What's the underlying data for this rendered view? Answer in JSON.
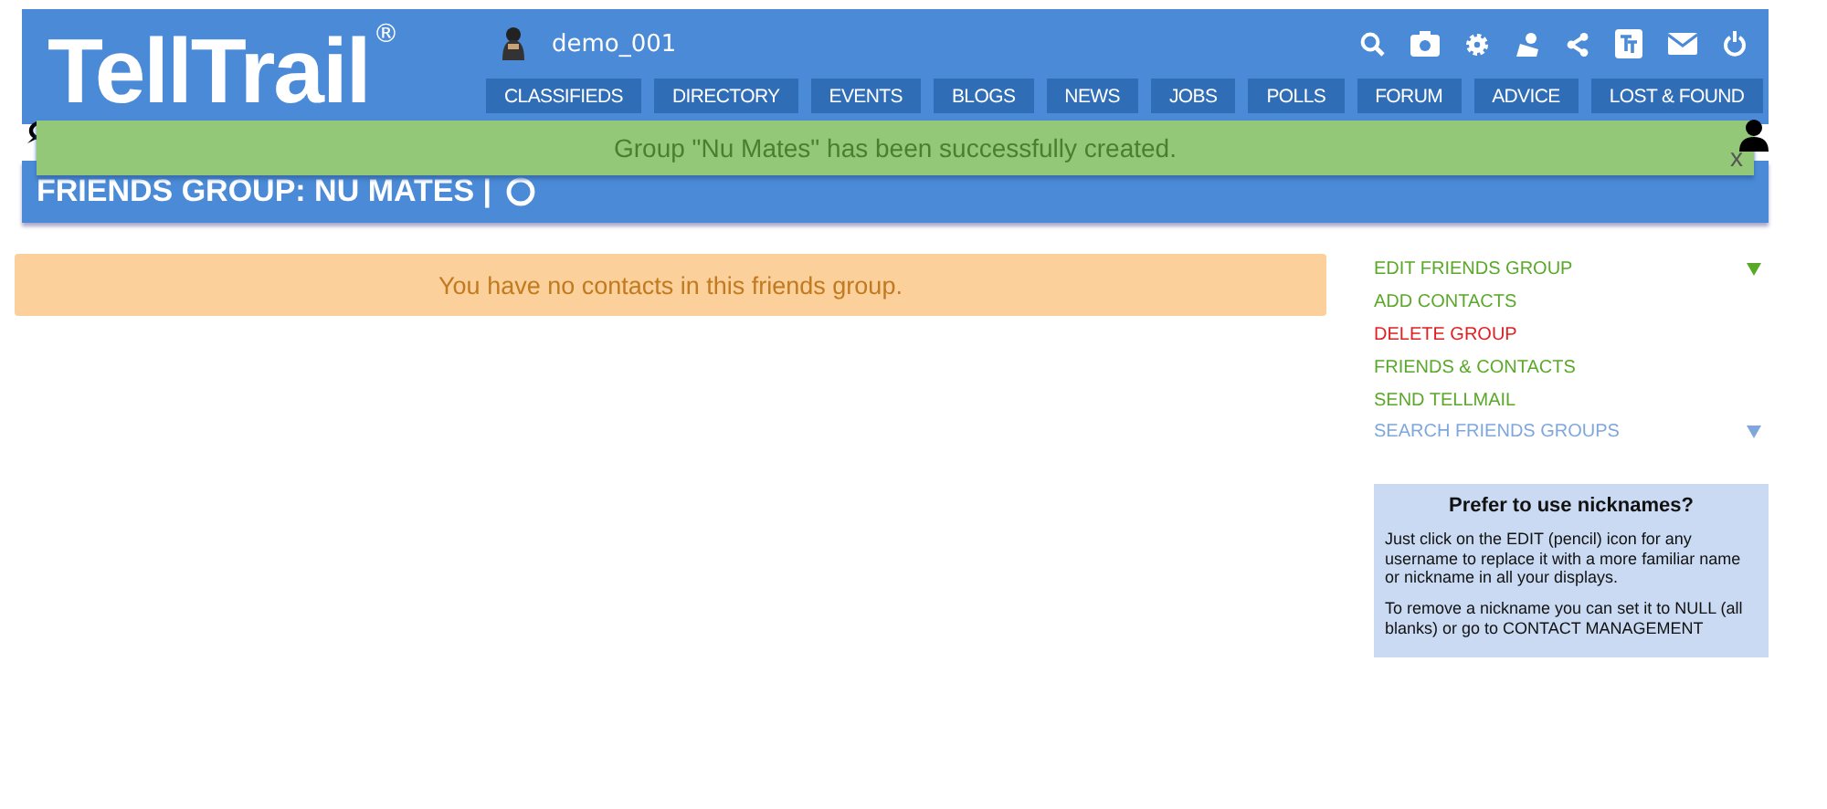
{
  "header": {
    "logo": "TellTrail",
    "logo_mark": "®",
    "username": "demo_001",
    "nav": [
      {
        "label": "CLASSIFIEDS"
      },
      {
        "label": "DIRECTORY"
      },
      {
        "label": "EVENTS"
      },
      {
        "label": "BLOGS"
      },
      {
        "label": "NEWS"
      },
      {
        "label": "JOBS"
      },
      {
        "label": "POLLS"
      },
      {
        "label": "FORUM"
      },
      {
        "label": "ADVICE"
      },
      {
        "label": "LOST & FOUND"
      }
    ]
  },
  "notification": {
    "message": "Group \"Nu Mates\" has been successfully created.",
    "close": "x"
  },
  "title_bar": {
    "title": "FRIENDS GROUP: NU MATES |"
  },
  "empty_message": "You have no contacts in this friends group.",
  "sidebar": {
    "items": [
      {
        "label": "EDIT FRIENDS GROUP",
        "color": "#5aa829",
        "toggle": true
      },
      {
        "label": "ADD CONTACTS",
        "color": "#5aa829",
        "toggle": false
      },
      {
        "label": "DELETE GROUP",
        "color": "#e02020",
        "toggle": false
      },
      {
        "label": "FRIENDS & CONTACTS",
        "color": "#5aa829",
        "toggle": false
      },
      {
        "label": "SEND TELLMAIL",
        "color": "#5aa829",
        "toggle": false
      },
      {
        "label": "SEARCH FRIENDS GROUPS",
        "color": "#7fa7dc",
        "toggle": true
      }
    ],
    "tip": {
      "title": "Prefer to use nicknames?",
      "paragraphs": [
        "Just click on the EDIT (pencil) icon for any username to replace it with a more familiar name or nickname in all your displays.",
        "To remove a nickname you can set it to NULL (all blanks) or go to CONTACT MANAGEMENT"
      ]
    }
  }
}
